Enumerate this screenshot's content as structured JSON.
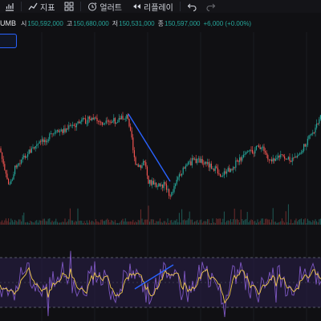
{
  "toolbar": {
    "indicators_label": "지표",
    "alert_label": "얼러트",
    "replay_label": "리플레이"
  },
  "legend": {
    "symbol_fragment": "UMB",
    "open_label": "시",
    "open_value": "150,592,000",
    "high_label": "고",
    "high_value": "150,680,000",
    "low_label": "저",
    "low_value": "150,531,000",
    "close_label": "종",
    "close_value": "150,597,000",
    "change_value": "+6,000 (+0.00%)"
  },
  "colors": {
    "background": "#101013",
    "up": "#26a69a",
    "down": "#ef5350",
    "trendline": "#2962ff",
    "oscillator_main": "#7e57c2",
    "oscillator_signal": "#f2c94c"
  },
  "icons": [
    "bar-chart-icon",
    "indicators-icon",
    "layout-grid-icon",
    "alert-clock-icon",
    "replay-icon",
    "undo-icon",
    "redo-icon"
  ]
}
